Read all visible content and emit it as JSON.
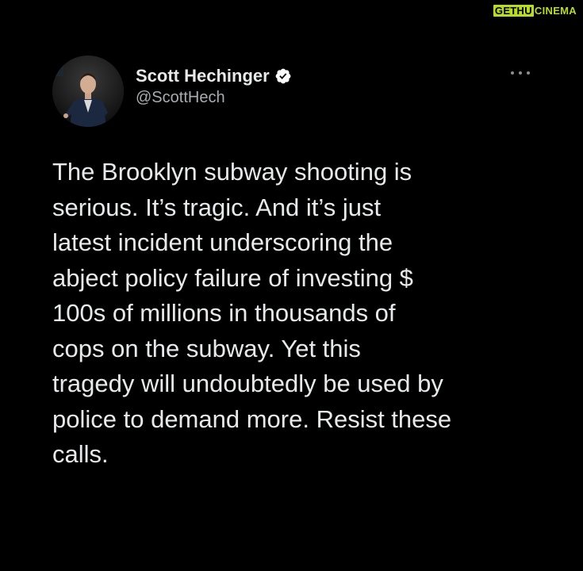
{
  "watermark": {
    "left": "GETHU",
    "right": "CINEMA"
  },
  "tweet": {
    "author": {
      "display_name": "Scott Hechinger",
      "handle": "@ScottHech",
      "verified": true,
      "avatar_icon": "avatar-photo"
    },
    "more_icon": "more-options-icon",
    "text_lines": [
      "The Brooklyn subway shooting is",
      "serious. It’s tragic. And it’s just",
      "latest incident underscoring the",
      "abject policy failure of investing $",
      "100s of millions in thousands of",
      "cops on the subway. Yet this",
      "tragedy will undoubtedly be used by",
      "police to demand more. Resist these",
      "calls."
    ]
  },
  "colors": {
    "background": "#000000",
    "text": "#e7e9ea",
    "handle": "#a9adb1",
    "verified_badge": "#ffffff",
    "watermark_accent": "#b9dc22"
  }
}
